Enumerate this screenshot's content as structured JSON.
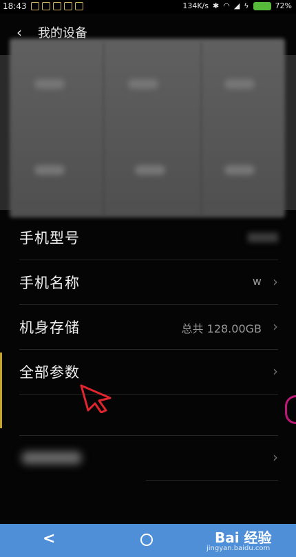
{
  "status_bar": {
    "time": "18:43",
    "speed": "134K/s",
    "battery": "72%",
    "icons": [
      "bluetooth-icon",
      "wifi-icon",
      "signal-icon",
      "charging-icon"
    ]
  },
  "header": {
    "title": "我的设备",
    "back_icon": "chevron-left-icon"
  },
  "settings": {
    "items": [
      {
        "label": "手机型号",
        "value": ""
      },
      {
        "label": "手机名称",
        "value": "w"
      },
      {
        "label": "机身存储",
        "value": "总共 128.00GB"
      },
      {
        "label": "全部参数",
        "value": ""
      }
    ]
  },
  "nav": {
    "back_icon": "back-triangle-icon",
    "home_icon": "home-circle-icon",
    "watermark": "Bai 经验",
    "watermark_sub": "jingyan.baidu.com"
  },
  "colors": {
    "background": "#050505",
    "nav_bar": "#4f8fd8",
    "pointer": "#e0252e",
    "battery": "#56b93a"
  }
}
